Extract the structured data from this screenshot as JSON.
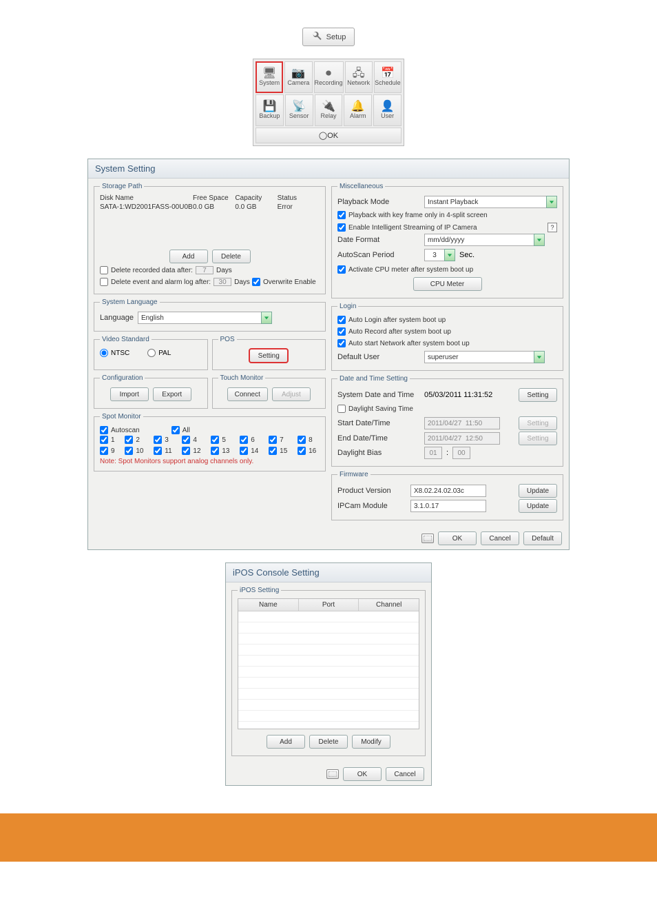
{
  "setup_label": "Setup",
  "nav": {
    "row1": [
      "System",
      "Camera",
      "Recording",
      "Network",
      "Schedule"
    ],
    "row2": [
      "Backup",
      "Sensor",
      "Relay",
      "Alarm",
      "User"
    ],
    "ok": "OK"
  },
  "system_window": {
    "title": "System Setting",
    "storage": {
      "legend": "Storage Path",
      "headers": [
        "Disk Name",
        "Free Space",
        "Capacity",
        "Status"
      ],
      "row": {
        "name": "SATA-1:WD2001FASS-00U0B",
        "free": "0.0 GB",
        "cap": "0.0 GB",
        "status": "Error"
      },
      "add": "Add",
      "delete": "Delete",
      "del_rec": "Delete recorded data after:",
      "del_rec_val": "7",
      "days": "Days",
      "del_evt": "Delete event and alarm log after:",
      "del_evt_val": "30",
      "overwrite": "Overwrite Enable"
    },
    "lang": {
      "legend": "System Language",
      "label": "Language",
      "value": "English"
    },
    "video": {
      "legend": "Video Standard",
      "ntsc": "NTSC",
      "pal": "PAL"
    },
    "pos": {
      "legend": "POS",
      "setting": "Setting"
    },
    "config": {
      "legend": "Configuration",
      "import": "Import",
      "export": "Export"
    },
    "touch": {
      "legend": "Touch Monitor",
      "connect": "Connect",
      "adjust": "Adjust"
    },
    "spot": {
      "legend": "Spot Monitor",
      "autoscan": "Autoscan",
      "all": "All",
      "ch": [
        "1",
        "2",
        "3",
        "4",
        "5",
        "6",
        "7",
        "8",
        "9",
        "10",
        "11",
        "12",
        "13",
        "14",
        "15",
        "16"
      ],
      "note": "Note: Spot Monitors support analog channels only."
    },
    "misc": {
      "legend": "Miscellaneous",
      "pb_mode_lbl": "Playback Mode",
      "pb_mode_val": "Instant Playback",
      "pb_key": "Playback with key frame only in 4-split screen",
      "enable_stream": "Enable Intelligent Streaming of IP Camera",
      "date_fmt_lbl": "Date Format",
      "date_fmt_val": "mm/dd/yyyy",
      "autoscan_lbl": "AutoScan Period",
      "autoscan_val": "3",
      "sec": "Sec.",
      "cpu_chk": "Activate CPU meter after system boot up",
      "cpu_btn": "CPU Meter"
    },
    "login": {
      "legend": "Login",
      "auto_login": "Auto Login after system boot up",
      "auto_rec": "Auto Record after system boot up",
      "auto_net": "Auto start Network after system boot up",
      "def_user_lbl": "Default User",
      "def_user_val": "superuser"
    },
    "dt": {
      "legend": "Date and Time Setting",
      "sys_lbl": "System Date and Time",
      "sys_val": "05/03/2011  11:31:52",
      "setting": "Setting",
      "dst": "Daylight Saving Time",
      "start_lbl": "Start Date/Time",
      "start_val": "2011/04/27  11:50",
      "end_lbl": "End Date/Time",
      "end_val": "2011/04/27  12:50",
      "bias_lbl": "Daylight Bias",
      "bias_h": "01",
      "bias_m": "00"
    },
    "fw": {
      "legend": "Firmware",
      "pv_lbl": "Product Version",
      "pv_val": "X8.02.24.02.03c",
      "update": "Update",
      "ip_lbl": "IPCam Module",
      "ip_val": "3.1.0.17"
    },
    "footer": {
      "ok": "OK",
      "cancel": "Cancel",
      "default": "Default"
    }
  },
  "ipos": {
    "title": "iPOS Console Setting",
    "legend": "iPOS Setting",
    "headers": [
      "Name",
      "Port",
      "Channel"
    ],
    "add": "Add",
    "delete": "Delete",
    "modify": "Modify",
    "ok": "OK",
    "cancel": "Cancel"
  }
}
